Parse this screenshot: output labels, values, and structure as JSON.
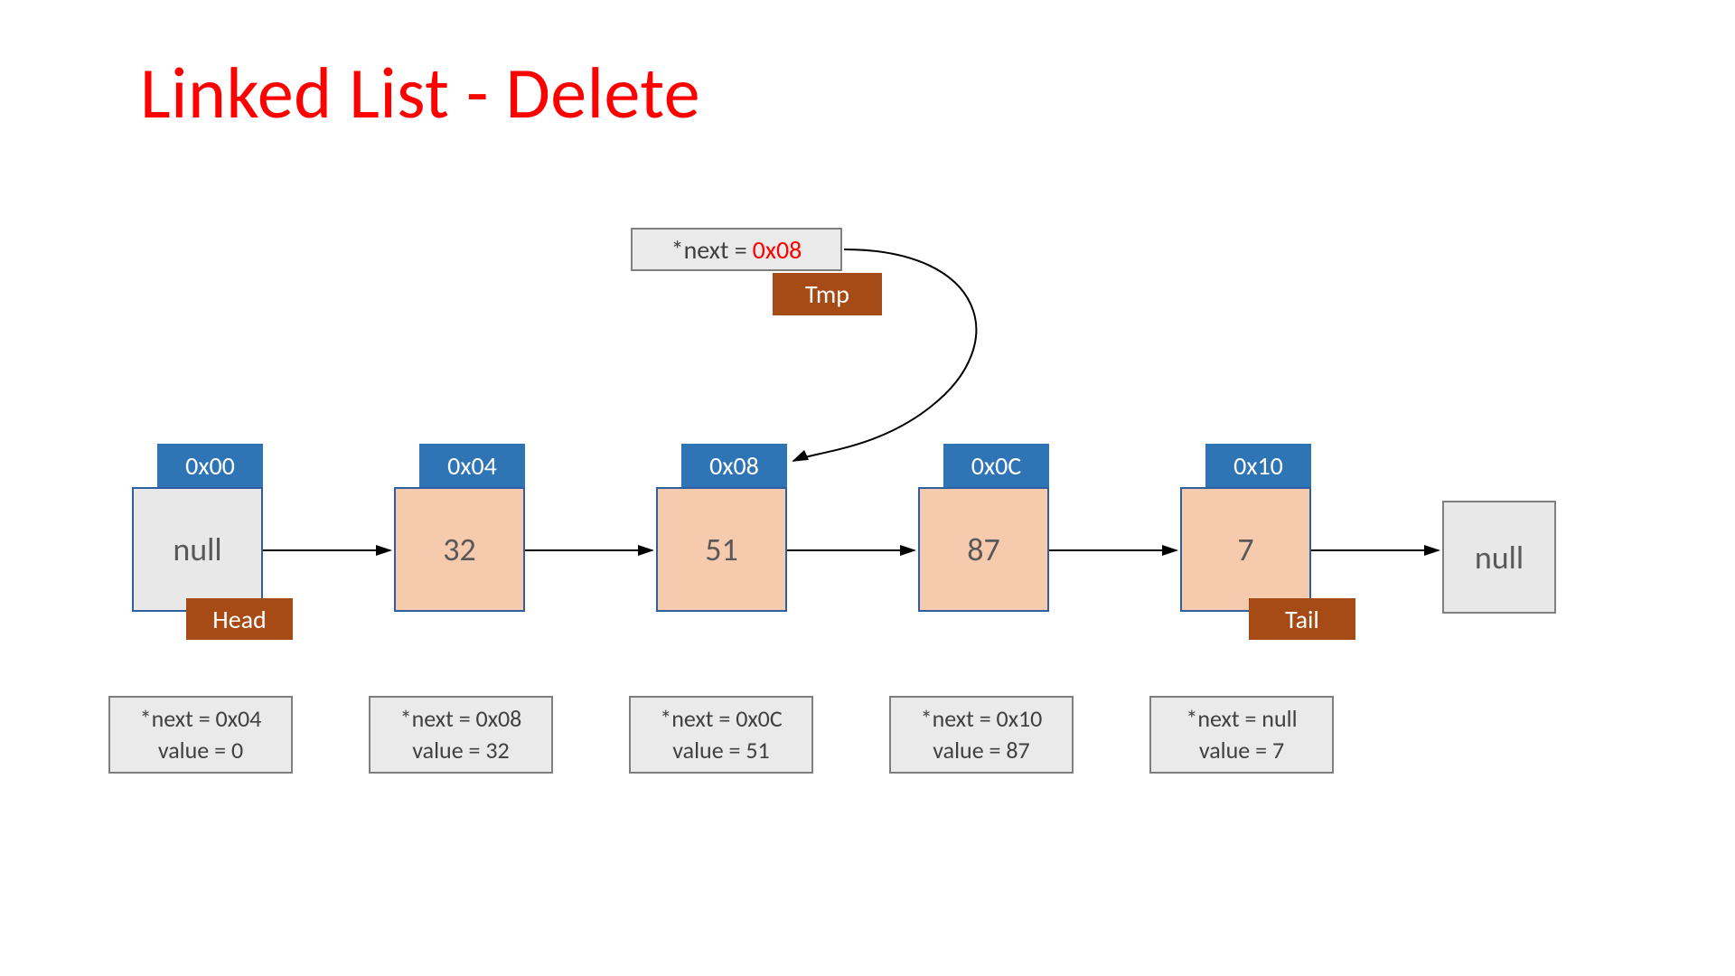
{
  "title": "Linked List - Delete",
  "tmp": {
    "prefix": "*next = ",
    "value": "0x08",
    "label": "Tmp"
  },
  "tags": {
    "head": "Head",
    "tail": "Tail"
  },
  "nodes": [
    {
      "addr": "0x00",
      "display": "null",
      "style": "grey",
      "info_next": "*next = 0x04",
      "info_val": "value = 0"
    },
    {
      "addr": "0x04",
      "display": "32",
      "style": "peach",
      "info_next": "*next = 0x08",
      "info_val": "value = 32"
    },
    {
      "addr": "0x08",
      "display": "51",
      "style": "peach",
      "info_next": "*next = 0x0C",
      "info_val": "value = 51"
    },
    {
      "addr": "0x0C",
      "display": "87",
      "style": "peach",
      "info_next": "*next = 0x10",
      "info_val": "value = 87"
    },
    {
      "addr": "0x10",
      "display": "7",
      "style": "peach",
      "info_next": "*next = null",
      "info_val": "value = 7"
    }
  ],
  "terminal": "null"
}
